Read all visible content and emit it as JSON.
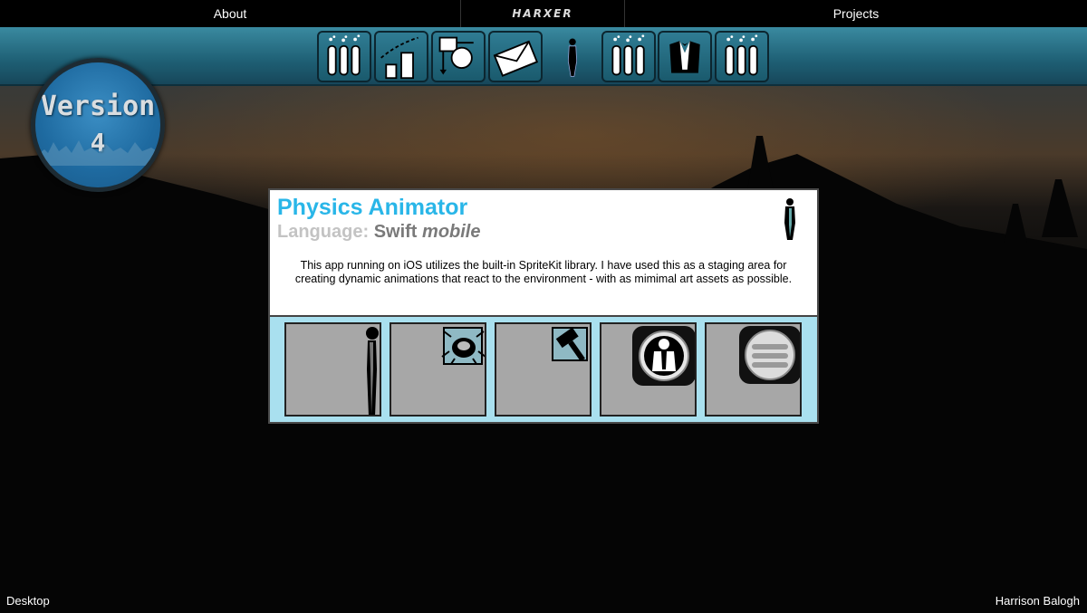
{
  "nav": {
    "about_label": "About",
    "brand": "HARXER",
    "projects_label": "Projects"
  },
  "toolbar": {
    "icons": [
      "chemistry-tubes-icon",
      "growth-chart-icon",
      "flowchart-icon",
      "envelope-icon",
      "human-figure-icon",
      "chemistry-tubes-icon",
      "tuxedo-icon",
      "chemistry-tubes-icon"
    ]
  },
  "version_badge": {
    "line1": "Version",
    "line2": "4"
  },
  "project": {
    "title": "Physics Animator",
    "language_label": "Language:",
    "language_value": "Swift",
    "platform": "mobile",
    "description": "This app running on iOS utilizes the built-in SpriteKit library. I have used this as a staging area for creating dynamic animations that react to the environment - with as mimimal art assets as possible.",
    "screenshots": [
      "standing-figure",
      "beetle-icon",
      "hammer-icon",
      "character-button",
      "menu-button"
    ]
  },
  "footer": {
    "left": "Desktop",
    "right": "Harrison Balogh"
  },
  "colors": {
    "title_blue": "#29b6e8",
    "toolbar_teal": "#1e5f74",
    "gallery_bg": "#a9e0ef",
    "badge_blue": "#1e6aa0"
  }
}
